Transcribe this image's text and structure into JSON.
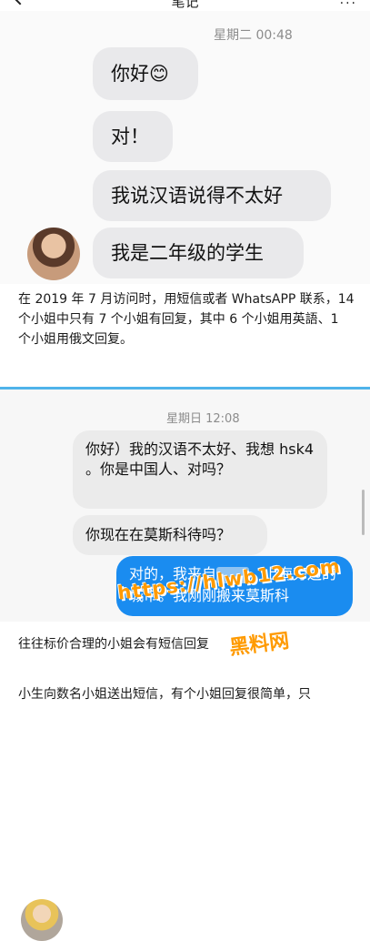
{
  "topbar": {
    "title": "笔记",
    "actions": "..."
  },
  "screenshot1": {
    "timestamp": "星期二 00:48",
    "messages": [
      "你好😊",
      "对！",
      "我说汉语说得不太好",
      "我是二年级的学生"
    ]
  },
  "paragraph1": "在 2019 年 7 月访问时，用短信或者 WhatsAPP 联系，14 个小姐中只有 7 个小姐有回复，其中 6 个小姐用英語、1 个小姐用俄文回复。",
  "screenshot2": {
    "timestamp": "星期日 12:08",
    "received": [
      "你好）我的汉语不太好、我想 hsk4 。你是中国人、对吗？",
      "你现在在莫斯科待吗？"
    ],
    "sent_before": "对的，我来自",
    "sent_after": "，上海旁边的城市。我刚刚搬来莫斯科",
    "accent_color": "#1a8cf0"
  },
  "paragraph2": "往往标价合理的小姐会有短信回复",
  "paragraph3": "小生向数名小姐送出短信，有个小姐回复很简单，只",
  "watermark": {
    "url": "https://hlwb12.com",
    "brand": "黑料网",
    "color": "#ff9a00"
  }
}
